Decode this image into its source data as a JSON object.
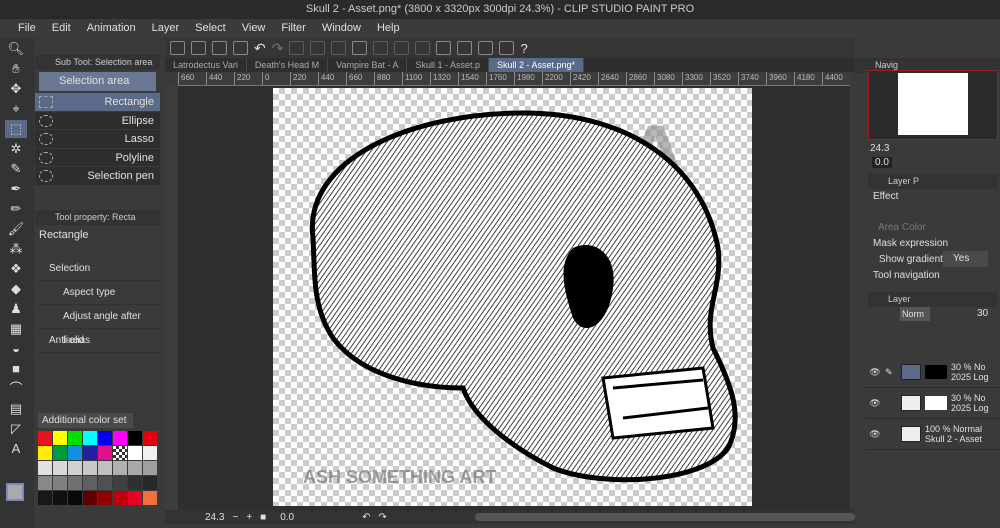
{
  "window": {
    "title": "Skull 2 - Asset.png* (3800 x 3320px 300dpi 24.3%)  - CLIP STUDIO PAINT PRO"
  },
  "menu": [
    "File",
    "Edit",
    "Animation",
    "Layer",
    "Select",
    "View",
    "Filter",
    "Window",
    "Help"
  ],
  "tabs": [
    "Latrodectus Vari",
    "Death's Head M",
    "Vampire Bat - A",
    "Skull 1 - Asset.p",
    "Skull 2 - Asset.png*"
  ],
  "ruler": [
    "660",
    "440",
    "220",
    "0",
    "220",
    "440",
    "660",
    "880",
    "1100",
    "1320",
    "1540",
    "1760",
    "1980",
    "2200",
    "2420",
    "2640",
    "2860",
    "3080",
    "3300",
    "3520",
    "3740",
    "3960",
    "4180",
    "4400"
  ],
  "subtool": {
    "header": "Sub Tool: Selection area",
    "group": "Selection area",
    "items": [
      "Rectangle",
      "Ellipse",
      "Lasso",
      "Polyline",
      "Selection pen"
    ]
  },
  "toolprop": {
    "header": "Tool property: Recta",
    "name": "Rectangle",
    "selection_label": "Selection",
    "aspect_label": "Aspect type",
    "adjust_label": "Adjust angle after fixed",
    "antialias_label": "Anti-alias"
  },
  "colorset": {
    "name": "Additional color set",
    "swatches": [
      "#e8141b",
      "#ffff00",
      "#00e000",
      "#00ffff",
      "#0000ee",
      "#ff00ff",
      "#000000",
      "#e00010",
      "#ffee00",
      "#009a40",
      "#1090e0",
      "#2020a0",
      "#e0108a",
      "checker",
      "#ffffff",
      "#f0f0f0",
      "#e0e0e0",
      "#d8d8d8",
      "#d0d0d0",
      "#c8c8c8",
      "#c0c0c0",
      "#b0b0b0",
      "#a8a8a8",
      "#a0a0a0",
      "#888888",
      "#808080",
      "#707070",
      "#606060",
      "#505050",
      "#404040",
      "#303030",
      "#282828",
      "#181818",
      "#101010",
      "#080808",
      "#600000",
      "#900000",
      "#c00010",
      "#e80020",
      "#f07040"
    ]
  },
  "status": {
    "zoom": "24.3",
    "angle": "0.0"
  },
  "navigator": {
    "tab": "Navig",
    "zoom": "24.3",
    "angle": "0.0"
  },
  "layerprop": {
    "tab": "Layer P",
    "effect": "Effect",
    "area_color": "Area Color",
    "mask_expression": "Mask expression",
    "show_gradients": "Show gradients",
    "show_gradients_value": "Yes",
    "tool_navigation": "Tool navigation"
  },
  "layers": {
    "tab": "Layer",
    "blend": "Norm",
    "opacity": "30",
    "items": [
      {
        "line1": "30 % No",
        "line2": "2025 Log"
      },
      {
        "line1": "30 % No",
        "line2": "2025 Log"
      },
      {
        "line1": "100 % Normal",
        "line2": "Skull 2 - Asset"
      }
    ]
  },
  "watermark": "ASH SOMETHING ART"
}
